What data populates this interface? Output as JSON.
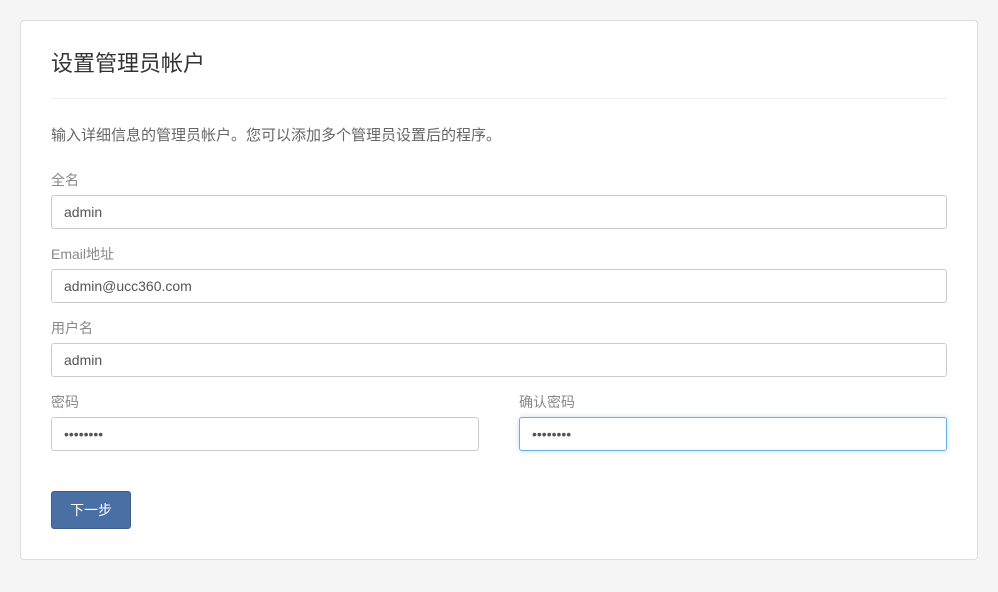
{
  "panel": {
    "title": "设置管理员帐户",
    "description": "输入详细信息的管理员帐户。您可以添加多个管理员设置后的程序。"
  },
  "form": {
    "fullname": {
      "label": "全名",
      "value": "admin"
    },
    "email": {
      "label": "Email地址",
      "value": "admin@ucc360.com"
    },
    "username": {
      "label": "用户名",
      "value": "admin"
    },
    "password": {
      "label": "密码",
      "value": "••••••••"
    },
    "confirm_password": {
      "label": "确认密码",
      "value": "••••••••"
    }
  },
  "actions": {
    "next_label": "下一步"
  }
}
